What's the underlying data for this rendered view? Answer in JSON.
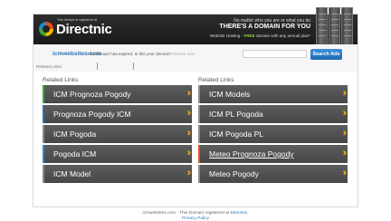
{
  "banner": {
    "registered_text": "This domain is registered at",
    "logo_text": "Directnic",
    "tagline_small": "No matter who you are or what you do",
    "tagline_big": "THERE'S A DOMAIN FOR YOU",
    "hosting_prefix": "Website Hosting -",
    "hosting_free": "FREE",
    "hosting_suffix": "domain with any annual plan*"
  },
  "infobar": {
    "domain": "icmwebsites.com",
    "expired_message": "This domain has expired. Is this your domain?",
    "expired_link": "Renew now",
    "search_placeholder": "",
    "search_button": "Search Ads",
    "related_links_label": "Related Links:"
  },
  "left_column": {
    "title": "Related Links",
    "items": [
      {
        "label": "ICM Prognoza Pogody",
        "accent": "#3aaa35"
      },
      {
        "label": "Prognoza Pogody ICM",
        "accent": "#2a72b5"
      },
      {
        "label": "ICM Pogoda",
        "accent": "#8a8a8a"
      },
      {
        "label": "Pogoda ICM",
        "accent": "#1d8bd1"
      },
      {
        "label": "ICM Model",
        "accent": "#8a8a8a"
      }
    ]
  },
  "right_column": {
    "title": "Related Links",
    "items": [
      {
        "label": "ICM Models",
        "accent": "#8a8a8a"
      },
      {
        "label": "ICM PL Pogoda",
        "accent": "#8a8a8a"
      },
      {
        "label": "ICM Pogoda PL",
        "accent": "#8a8a8a"
      },
      {
        "label": "Meteo Prognoza Pogody",
        "accent": "#e94e1b"
      },
      {
        "label": "Meteo Pogody",
        "accent": "#8a8a8a"
      }
    ]
  },
  "footer": {
    "prefix": "icmwebsites.com - This Domain registered at",
    "brand": "Directnic.",
    "privacy": "Privacy Policy"
  },
  "colors": {
    "arrow": "#f3a300",
    "link_blue": "#2a72b5"
  }
}
